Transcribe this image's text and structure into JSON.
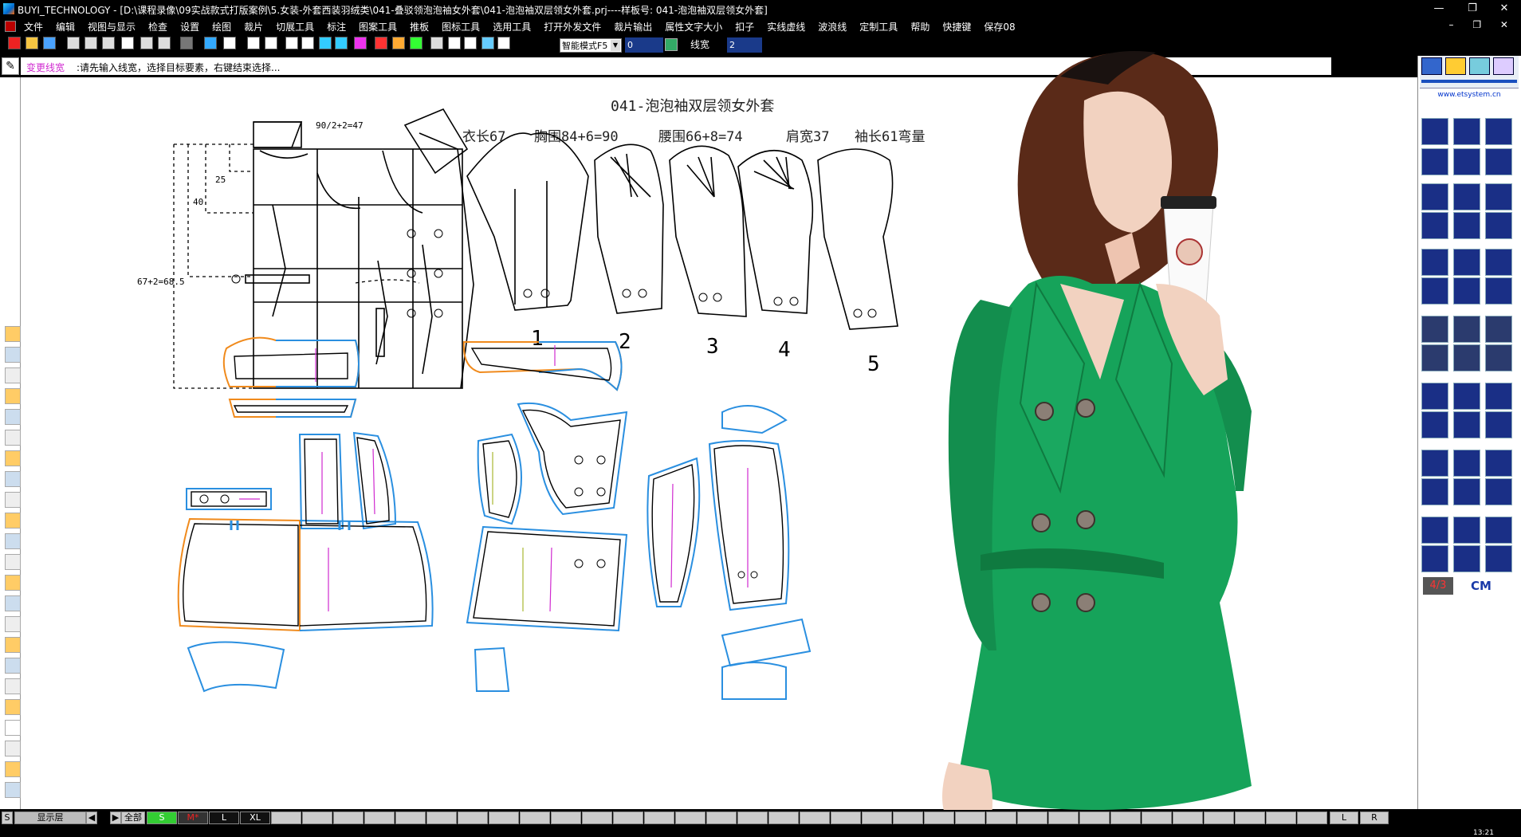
{
  "window": {
    "title": "BUYI_TECHNOLOGY - [D:\\课程录像\\09实战款式打版案例\\5.女装-外套西装羽绒类\\041-叠驳领泡泡袖女外套\\041-泡泡袖双层领女外套.prj----样板号: 041-泡泡袖双层领女外套]",
    "buttons": {
      "minimize": "—",
      "restore": "❐",
      "close": "✕"
    }
  },
  "menu": {
    "items": [
      "文件",
      "编辑",
      "视图与显示",
      "检查",
      "设置",
      "绘图",
      "裁片",
      "切展工具",
      "标注",
      "图案工具",
      "推板",
      "图标工具",
      "选用工具",
      "打开外发文件",
      "裁片输出",
      "属性文字大小",
      "扣子",
      "实线虚线",
      "波浪线",
      "定制工具",
      "帮助",
      "快捷键",
      "保存08"
    ],
    "mdi_buttons": "– ❐ ✕"
  },
  "toolbar": {
    "mode_select": "智能模式F5",
    "field_a": "0",
    "linewidth_label": "线宽",
    "field_b": "2",
    "icons": [
      "new-icon",
      "open-icon",
      "save-icon",
      "zoom-out-icon",
      "zoom-in-icon",
      "full-view-icon",
      "pan-hand-icon",
      "zoom-window-icon",
      "undo-icon",
      "redo-icon",
      "select-arrow-icon",
      "move-icon",
      "measure-icon",
      "cross-icon",
      "rotate-icon",
      "fork-icon",
      "line-icon",
      "parallel-icon",
      "pen-icon",
      "hatch-icon",
      "palette-icon",
      "star-icon",
      "grid-icon",
      "notch-icon",
      "ruler-icon",
      "frame-icon",
      "settings-icon"
    ]
  },
  "prompt": {
    "command": "变更线宽",
    "text": ":请先输入线宽，选择目标要素，右键结束选择..."
  },
  "drawing": {
    "title": "041-泡泡袖双层领女外套",
    "specs": [
      "衣长67",
      "胸围84+6=90",
      "腰围66+8=74",
      "肩宽37",
      "袖长61弯量"
    ],
    "dim_labels": [
      "90/2+2=47",
      "25",
      "40",
      "67+2=68.5"
    ],
    "sleeve_numbers": [
      "1",
      "2",
      "3",
      "4",
      "5"
    ]
  },
  "right_panel": {
    "logo_text": "www.etsystem.cn",
    "size_label": "4/3",
    "unit_label": "CM"
  },
  "statusbar": {
    "layer_label": "显示层",
    "all_label": "全部",
    "prefix": "S",
    "sizes": [
      "S",
      "M*",
      "L",
      "XL"
    ],
    "lr": [
      "L",
      "R"
    ],
    "clock": "13:21"
  },
  "colors": {
    "accent_cmd": "#d02ad0",
    "size_active": "#33cc33",
    "seam_blue": "#2a8fe0",
    "piece_orange": "#f08a1c",
    "grain_magenta": "#d02ad0",
    "coat_green": "#16a35a"
  }
}
